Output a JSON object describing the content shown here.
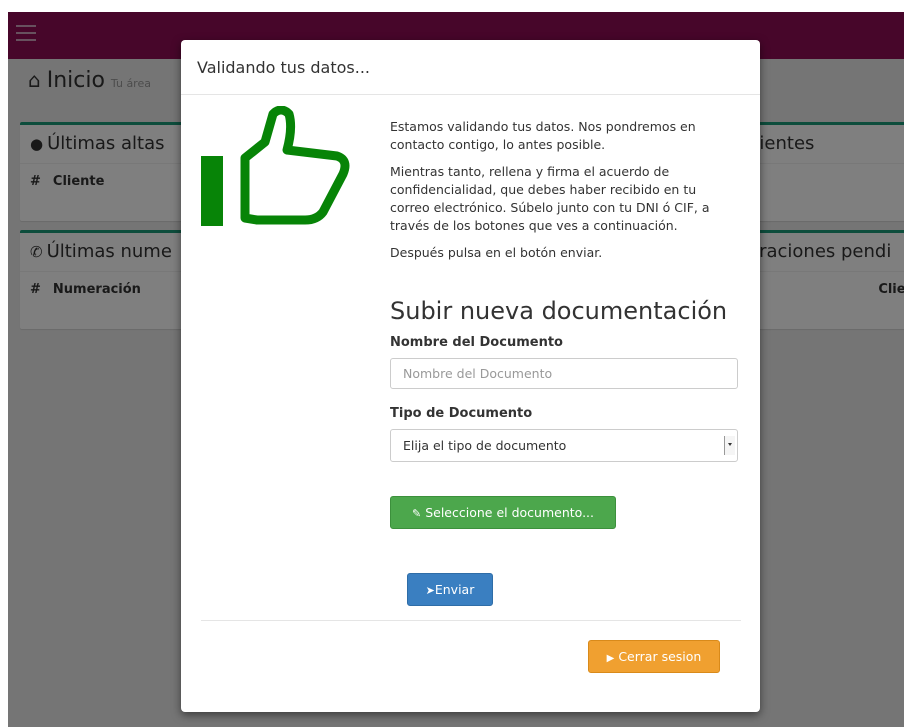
{
  "background": {
    "page_title": "Inicio",
    "page_subtitle": "Tu área",
    "panel_left_1": {
      "title": "Últimas altas",
      "col_hash": "#",
      "col_label": "Cliente"
    },
    "panel_left_2": {
      "title": "Últimas nume",
      "col_hash": "#",
      "col_label": "Numeración"
    },
    "panel_right_1": {
      "title": "dientes"
    },
    "panel_right_2": {
      "title": "eraciones pendi",
      "col_label": "Clier"
    }
  },
  "modal": {
    "title": "Validando tus datos...",
    "paragraphs": [
      "Estamos validando tus datos. Nos pondremos en contacto contigo, lo antes posible.",
      "Mientras tanto, rellena y firma el acuerdo de confidencialidad, que debes haber recibido en tu correo electrónico. Súbelo junto con tu DNI ó CIF, a través de los botones que ves a continuación.",
      "Después pulsa en el botón enviar."
    ],
    "section_title": "Subir nueva documentación",
    "doc_name_label": "Nombre del Documento",
    "doc_name_placeholder": "Nombre del Documento",
    "doc_type_label": "Tipo de Documento",
    "doc_type_selected": "Elija el tipo de documento",
    "select_file_label": "Seleccione el documento...",
    "send_label": "Enviar",
    "logout_label": "Cerrar sesion"
  },
  "colors": {
    "topbar": "#8e0c55",
    "panel_accent": "#1a9a78",
    "thumb_icon": "#078407",
    "btn_green": "#4ca74c",
    "btn_blue": "#3a7fc1",
    "btn_orange": "#f0a030"
  },
  "icons": [
    "menu-icon",
    "home-icon",
    "users-icon",
    "phone-icon",
    "thumbs-up-icon",
    "paperclip-icon",
    "send-icon",
    "logout-icon"
  ]
}
